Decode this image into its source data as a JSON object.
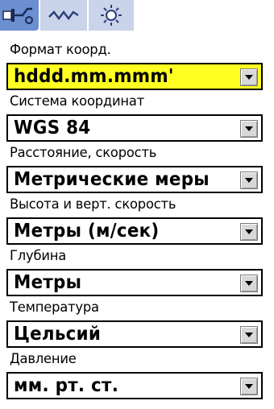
{
  "tabs": [
    {
      "icon": "tractor-icon"
    },
    {
      "icon": "signal-wave-icon"
    },
    {
      "icon": "sun-icon"
    }
  ],
  "settings": [
    {
      "label": "Формат коорд.",
      "value": "hddd.mm.mmm'",
      "selected": true
    },
    {
      "label": "Система координат",
      "value": "WGS 84",
      "selected": false
    },
    {
      "label": "Расстояние, скорость",
      "value": "Метрические меры",
      "selected": false
    },
    {
      "label": "Высота и верт. скорость",
      "value": "Метры (м/сек)",
      "selected": false
    },
    {
      "label": "Глубина",
      "value": "Метры",
      "selected": false
    },
    {
      "label": "Температура",
      "value": "Цельсий",
      "selected": false
    },
    {
      "label": "Давление",
      "value": "мм. рт. ст.",
      "selected": false
    }
  ],
  "colors": {
    "selected_field": "#ffff22",
    "active_tab": "#6b8fd0",
    "inactive_tab": "#c9d4ea"
  }
}
